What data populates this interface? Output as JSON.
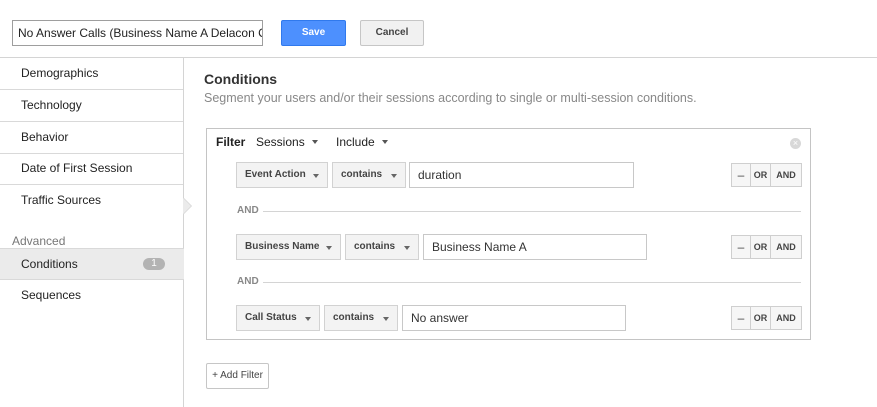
{
  "header": {
    "segment_name": "No Answer Calls (Business Name A Delacon Call)",
    "save_label": "Save",
    "cancel_label": "Cancel"
  },
  "sidebar": {
    "items": [
      {
        "label": "Demographics"
      },
      {
        "label": "Technology"
      },
      {
        "label": "Behavior"
      },
      {
        "label": "Date of First Session"
      },
      {
        "label": "Traffic Sources"
      }
    ],
    "advanced_label": "Advanced",
    "advanced_items": [
      {
        "label": "Conditions",
        "badge": "1",
        "active": true
      },
      {
        "label": "Sequences"
      }
    ]
  },
  "main": {
    "title": "Conditions",
    "subtitle": "Segment your users and/or their sessions according to single or multi-session conditions.",
    "filter": {
      "label": "Filter",
      "scope": "Sessions",
      "mode": "Include",
      "remove_icon": "close-circle-icon",
      "conjunction": "AND",
      "conditions": [
        {
          "dimension": "Event Action",
          "operator": "contains",
          "value": "duration"
        },
        {
          "dimension": "Business Name",
          "operator": "contains",
          "value": "Business Name A"
        },
        {
          "dimension": "Call Status",
          "operator": "contains",
          "value": "No answer"
        }
      ],
      "ops": {
        "minus": "–",
        "or": "OR",
        "and": "AND"
      }
    },
    "add_filter_label": "+ Add Filter"
  },
  "colors": {
    "save_button": "#4d90fe",
    "active_sidebar_bg": "#ebebeb",
    "badge_bg": "#b3b3b3"
  }
}
